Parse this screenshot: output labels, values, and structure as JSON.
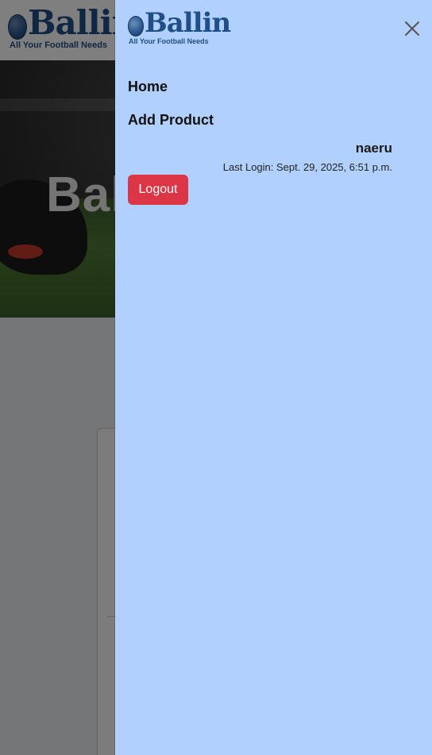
{
  "brand": {
    "name": "Ballin",
    "tagline": "All Your Football Needs",
    "color": "#1f4f86"
  },
  "hero": {
    "title_fragment": "Bal"
  },
  "drawer": {
    "background": "#b1d0fd",
    "close_icon": "close-icon",
    "nav": [
      {
        "label": "Home"
      },
      {
        "label": "Add Product"
      }
    ],
    "user": {
      "name": "naeru",
      "last_login": "Last Login: Sept. 29, 2025, 6:51 p.m."
    },
    "logout_label": "Logout",
    "logout_color": "#dc3545"
  }
}
